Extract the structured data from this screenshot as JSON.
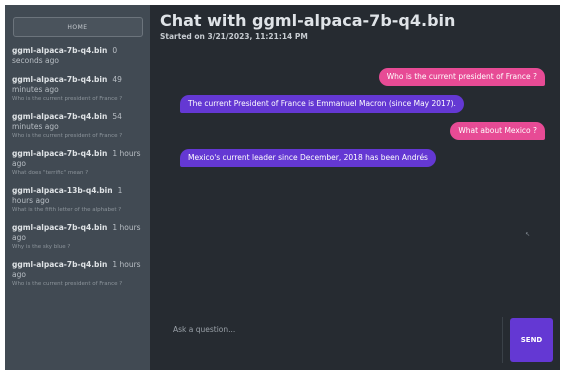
{
  "sidebar": {
    "home_label": "HOME",
    "chats": [
      {
        "model": "ggml-alpaca-7b-q4.bin",
        "time": "0 seconds ago",
        "preview": ""
      },
      {
        "model": "ggml-alpaca-7b-q4.bin",
        "time": "49 minutes ago",
        "preview": "Who is the current president of France ?"
      },
      {
        "model": "ggml-alpaca-7b-q4.bin",
        "time": "54 minutes ago",
        "preview": "Who is the current president of France ?"
      },
      {
        "model": "ggml-alpaca-7b-q4.bin",
        "time": "1 hours ago",
        "preview": "What does \"terrific\" mean ?"
      },
      {
        "model": "ggml-alpaca-13b-q4.bin",
        "time": "1 hours ago",
        "preview": "What is the fifth letter of the alphabet ?"
      },
      {
        "model": "ggml-alpaca-7b-q4.bin",
        "time": "1 hours ago",
        "preview": "Why is the sky blue ?"
      },
      {
        "model": "ggml-alpaca-7b-q4.bin",
        "time": "1 hours ago",
        "preview": "Who is the current president of France ?"
      }
    ]
  },
  "chat": {
    "title": "Chat with ggml-alpaca-7b-q4.bin",
    "started": "Started on 3/21/2023, 11:21:14 PM",
    "messages": [
      {
        "role": "user",
        "text": "Who is the current president of France ?"
      },
      {
        "role": "bot",
        "text": "The current President of France is Emmanuel Macron (since May 2017)."
      },
      {
        "role": "user",
        "text": "What about Mexico ?"
      },
      {
        "role": "bot",
        "text": "Mexico's current leader since December, 2018 has been Andrés"
      }
    ]
  },
  "composer": {
    "placeholder": "Ask a question...",
    "send_label": "SEND"
  },
  "colors": {
    "user_bubble": "#e74b95",
    "bot_bubble": "#6438d3",
    "sidebar_bg": "#414a53",
    "main_bg": "#262b31"
  }
}
